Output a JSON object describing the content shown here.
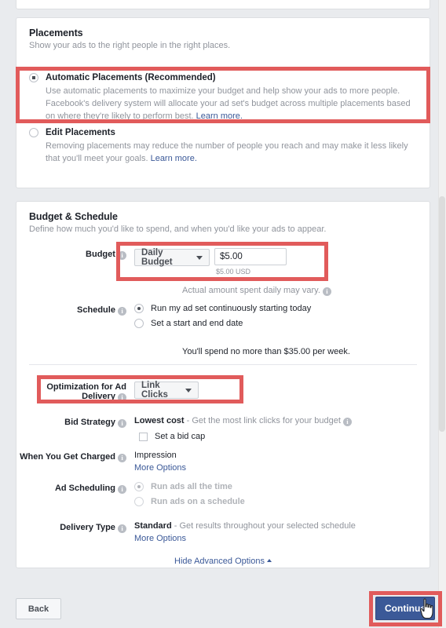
{
  "placements": {
    "title": "Placements",
    "subtitle": "Show your ads to the right people in the right places.",
    "options": [
      {
        "label": "Automatic Placements (Recommended)",
        "description": "Use automatic placements to maximize your budget and help show your ads to more people. Facebook's delivery system will allocate your ad set's budget across multiple placements based on where they're likely to perform best.",
        "learn_more": "Learn more.",
        "selected": true
      },
      {
        "label": "Edit Placements",
        "description": "Removing placements may reduce the number of people you reach and may make it less likely that you'll meet your goals.",
        "learn_more": "Learn more.",
        "selected": false
      }
    ]
  },
  "budget": {
    "title": "Budget & Schedule",
    "subtitle": "Define how much you'd like to spend, and when you'd like your ads to appear.",
    "budget_label": "Budget",
    "budget_type": "Daily Budget",
    "budget_amount": "$5.00",
    "budget_currency": "$5.00 USD",
    "budget_note": "Actual amount spent daily may vary.",
    "schedule_label": "Schedule",
    "schedule_options": [
      {
        "label": "Run my ad set continuously starting today",
        "selected": true
      },
      {
        "label": "Set a start and end date",
        "selected": false
      }
    ],
    "spend_note": "You'll spend no more than $35.00 per week.",
    "optimization_label": "Optimization for Ad Delivery",
    "optimization_value": "Link Clicks",
    "bid_strategy_label": "Bid Strategy",
    "bid_strategy_value": "Lowest cost",
    "bid_strategy_desc": "- Get the most link clicks for your budget",
    "bid_cap_label": "Set a bid cap",
    "charged_label": "When You Get Charged",
    "charged_value": "Impression",
    "charged_more": "More Options",
    "ad_scheduling_label": "Ad Scheduling",
    "ad_scheduling_options": [
      {
        "label": "Run ads all the time",
        "selected": true
      },
      {
        "label": "Run ads on a schedule",
        "selected": false
      }
    ],
    "delivery_label": "Delivery Type",
    "delivery_value": "Standard",
    "delivery_desc": "- Get results throughout your selected schedule",
    "delivery_more": "More Options",
    "hide_advanced": "Hide Advanced Options"
  },
  "footer": {
    "back_label": "Back",
    "continue_label": "Continue"
  },
  "colors": {
    "highlight": "#e15b5b",
    "brand_blue": "#3b5998",
    "page_bg": "#e9ebee"
  }
}
